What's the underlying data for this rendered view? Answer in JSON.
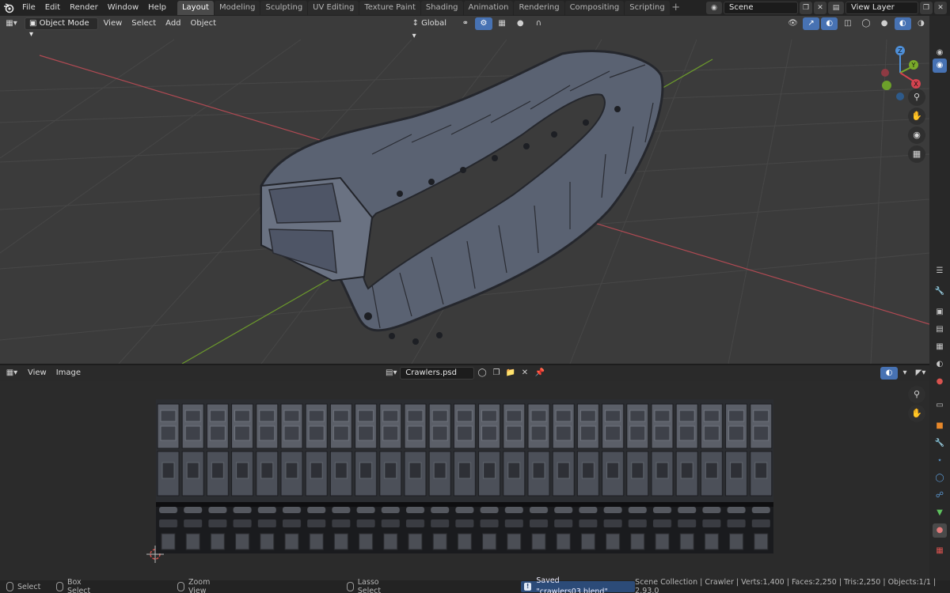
{
  "topbar": {
    "menus": [
      "File",
      "Edit",
      "Render",
      "Window",
      "Help"
    ],
    "workspaces": [
      "Layout",
      "Modeling",
      "Sculpting",
      "UV Editing",
      "Texture Paint",
      "Shading",
      "Animation",
      "Rendering",
      "Compositing",
      "Scripting"
    ],
    "active_workspace": "Layout",
    "add_tab": "+",
    "scene": "Scene",
    "view_layer": "View Layer"
  },
  "viewport": {
    "mode": "Object Mode",
    "menus": [
      "View",
      "Select",
      "Add",
      "Object"
    ],
    "transform_orientation": "Global",
    "gizmo_axes": [
      "X",
      "Y",
      "Z"
    ],
    "colors": {
      "background": "#3b3b3b",
      "grid": "#4a4a4a",
      "x_axis": "#b04a53",
      "y_axis": "#6c9a2c",
      "track_base": "#5a6272",
      "track_dark": "#25272d"
    }
  },
  "image_editor": {
    "menus": [
      "View",
      "Image"
    ],
    "image_name": "Crawlers.psd"
  },
  "status": {
    "select": "Select",
    "box_select": "Box Select",
    "zoom_view": "Zoom View",
    "lasso_select": "Lasso Select",
    "saved_message": "Saved \"crawlers03.blend\"",
    "stats": "Scene Collection | Crawler | Verts:1,400 | Faces:2,250 | Tris:2,250 | Objects:1/1 | 2.93.0"
  },
  "icons": {
    "blender_logo": "blender-logo-icon",
    "zoom": "zoom-icon",
    "hand": "hand-icon",
    "camera": "camera-icon",
    "ortho_grid": "grid-icon"
  }
}
